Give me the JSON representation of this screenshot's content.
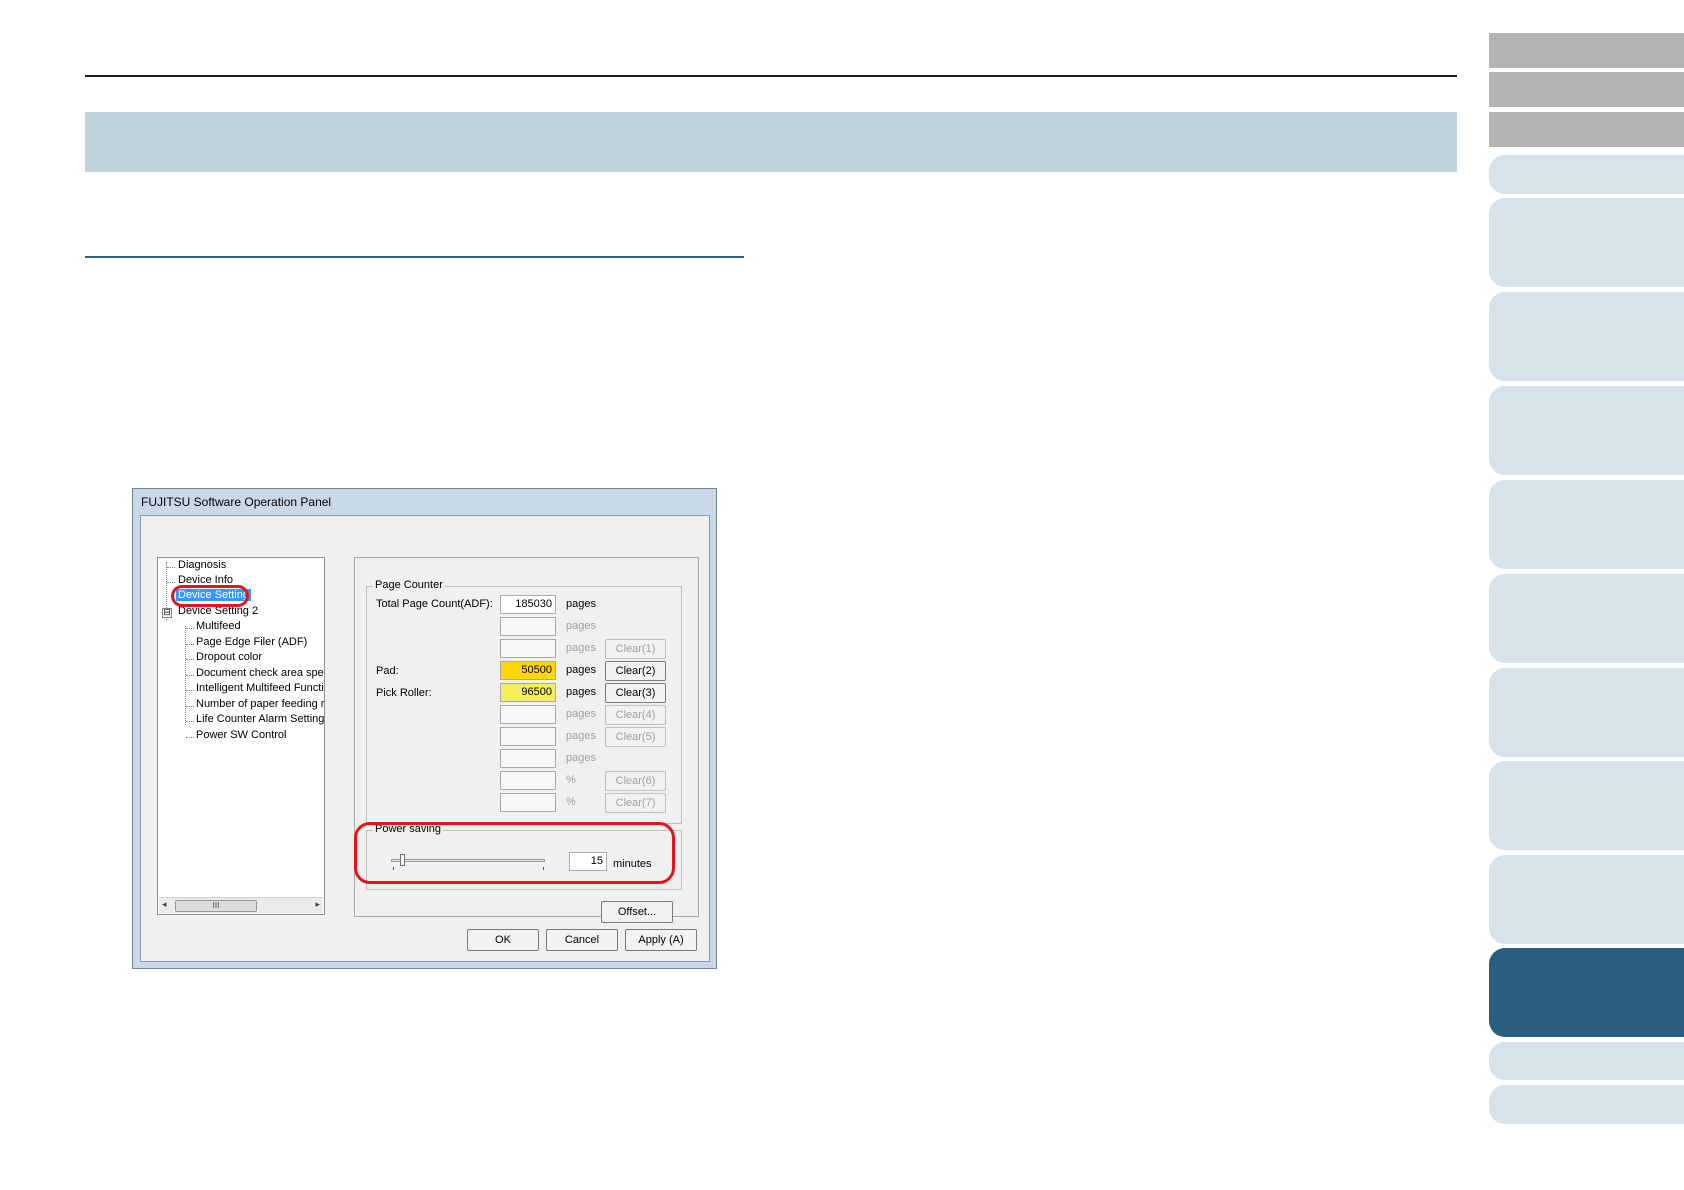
{
  "nav_tabs": {
    "count_gray": 3,
    "count_light": 10,
    "active_index": 10
  },
  "dialog": {
    "title": "FUJITSU Software Operation Panel",
    "tree": {
      "items": [
        {
          "label": "Diagnosis",
          "level": 0
        },
        {
          "label": "Device Info",
          "level": 0
        },
        {
          "label": "Device Setting",
          "level": 0,
          "selected": true
        },
        {
          "label": "Device Setting 2",
          "level": 0,
          "expanded": true
        },
        {
          "label": "Multifeed",
          "level": 1
        },
        {
          "label": "Page Edge Filer (ADF)",
          "level": 1
        },
        {
          "label": "Dropout color",
          "level": 1
        },
        {
          "label": "Document check area specific",
          "level": 1
        },
        {
          "label": "Intelligent Multifeed Function",
          "level": 1
        },
        {
          "label": "Number of paper feeding retrie",
          "level": 1
        },
        {
          "label": "Life Counter Alarm Setting",
          "level": 1
        },
        {
          "label": "Power SW Control",
          "level": 1
        }
      ],
      "expander_symbol": "⊟",
      "scroll_thumb": "III",
      "scroll_left": "◂",
      "scroll_right": "▸"
    },
    "page_counter": {
      "group_label": "Page Counter",
      "total_label": "Total Page Count(ADF):",
      "total_value": "185030",
      "pad_label": "Pad:",
      "pad_value": "50500",
      "pick_label": "Pick Roller:",
      "pick_value": "96500",
      "unit_pages": "pages",
      "unit_percent": "%",
      "clear1": "Clear(1)",
      "clear2": "Clear(2)",
      "clear3": "Clear(3)",
      "clear4": "Clear(4)",
      "clear5": "Clear(5)",
      "clear6": "Clear(6)",
      "clear7": "Clear(7)"
    },
    "power_saving": {
      "group_label": "Power saving",
      "value": "15",
      "unit": "minutes",
      "slider_level": 0.07
    },
    "offset_button": "Offset...",
    "ok_button": "OK",
    "cancel_button": "Cancel",
    "apply_button": "Apply (A)"
  }
}
